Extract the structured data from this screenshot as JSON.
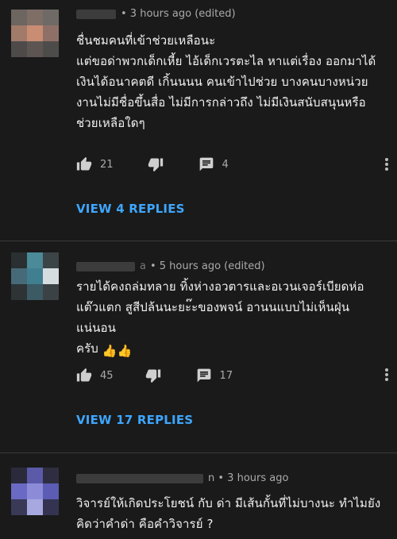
{
  "comments": [
    {
      "timestamp": "• 3 hours ago (edited)",
      "lines": [
        "ชื่นชมคนที่เข้าช่วยเหลือนะ",
        "แต่ขอด่าพวกเด็กเหี้ย ไอ้เด็กเวรตะไล หาแต่เรื่อง ออกมาได้",
        "เงินได้อนาคตดี เกิ้นนนน คนเข้าไปช่วย บางคนบางหน่วย",
        "งานไม่มีชื่อขึ้นสื่อ ไม่มีการกล่าวถึง ไม่มีเงินสนับสนุนหรือ",
        "ช่วยเหลือใดๆ"
      ],
      "likes": "21",
      "reply_count_icon_label": "4",
      "view_replies": "VIEW 4 REPLIES",
      "avatar_colors": [
        "#6d6560",
        "#7e6e66",
        "#6f6a66",
        "#a27a6a",
        "#c98d73",
        "#8f7068",
        "#4d4a49",
        "#5d5552",
        "#4e4c4b"
      ]
    },
    {
      "timestamp": "• 5 hours ago (edited)",
      "timestamp_prefix": "a",
      "lines": [
        "รายได้คงถล่มทลาย ทิ้งห่างอวตารและอเวนเจอร์เบียดห่อ",
        "แต๊วแตก สูสีปล้นนะยะ๊ะของพจน์ อานนแบบไม่เห็นฝุ่นแน่นอน",
        "ครับ"
      ],
      "emoji": "👍👍",
      "likes": "45",
      "reply_count_icon_label": "17",
      "view_replies": "VIEW 17 REPLIES",
      "avatar_colors": [
        "#2a2f31",
        "#4b8a99",
        "#3b4547",
        "#476a78",
        "#3f7f8f",
        "#d6dde0",
        "#2e3436",
        "#3b5a64",
        "#3a4245"
      ]
    },
    {
      "timestamp": "n • 3 hours ago",
      "lines": [
        "วิจารย์ให้เกิดประโยชน์ กับ ด่า มีเส้นกั้นที่ไม่บางนะ ทำไมยัง",
        "คิดว่าคำด่า คือคำวิจารย์ ?"
      ],
      "avatar_colors": [
        "#2a2a3c",
        "#5a5aa8",
        "#2e2e40",
        "#6a6ac4",
        "#8b8bd8",
        "#5c5cb4",
        "#3a3a58",
        "#a8a8e0",
        "#343452"
      ]
    }
  ],
  "colors": {
    "background": "#1a1a1a",
    "text": "#f1f1f1",
    "muted": "#aaaaaa",
    "link": "#3ea6ff",
    "divider": "#3a3a3a"
  },
  "icons": {
    "like": "thumbs-up-icon",
    "dislike": "thumbs-down-icon",
    "reply": "comment-icon",
    "more": "more-vertical-icon"
  }
}
